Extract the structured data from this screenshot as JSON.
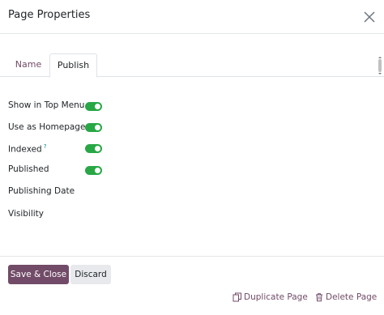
{
  "dialog": {
    "title": "Page Properties",
    "close_icon": "close-icon"
  },
  "tabs": [
    {
      "label": "Name",
      "active": false
    },
    {
      "label": "Publish",
      "active": true
    }
  ],
  "fields": {
    "show_in_top_menu": {
      "label": "Show in Top Menu",
      "value": true
    },
    "use_as_homepage": {
      "label": "Use as Homepage",
      "value": true
    },
    "indexed": {
      "label": "Indexed",
      "help": "?",
      "value": true
    },
    "published": {
      "label": "Published",
      "value": true
    },
    "publishing_date": {
      "label": "Publishing Date"
    },
    "visibility": {
      "label": "Visibility"
    }
  },
  "footer": {
    "save_label": "Save & Close",
    "discard_label": "Discard",
    "duplicate_label": "Duplicate Page",
    "delete_label": "Delete Page"
  },
  "colors": {
    "brand": "#714b67",
    "toggle_on": "#28a745",
    "help": "#017e84"
  }
}
